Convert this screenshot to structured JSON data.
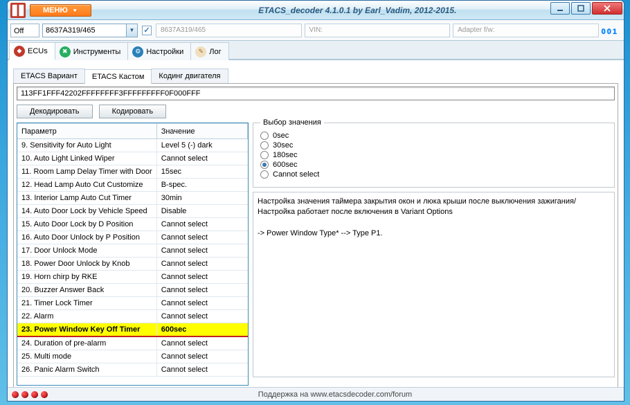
{
  "window": {
    "title": "ETACS_decoder 4.1.0.1 by Earl_Vadim, 2012-2015.",
    "menu_button": "МЕНЮ"
  },
  "toolbar": {
    "state_label": "Off",
    "combo_value": "8637A319/465",
    "check_value": "✓",
    "info1": "8637A319/465",
    "info2_hdr": "VIN:",
    "info3_hdr": "Adapter f/w:",
    "counter": "001"
  },
  "main_tabs": {
    "t1": "ECUs",
    "t2": "Инструменты",
    "t3": "Настройки",
    "t4": "Лог"
  },
  "sub_tabs": {
    "s1": "ETACS Вариант",
    "s2": "ETACS Кастом",
    "s3": "Кодинг двигателя"
  },
  "hex_value": "113FF1FFF42202FFFFFFFF3FFFFFFFFF0F000FFF",
  "buttons": {
    "decode": "Декодировать",
    "encode": "Кодировать"
  },
  "grid": {
    "col1": "Параметр",
    "col2": "Значение",
    "rows": [
      {
        "p": "9. Sensitivity for Auto Light",
        "v": "Level 5 (-) dark",
        "sel": false
      },
      {
        "p": "10. Auto Light Linked Wiper",
        "v": "Cannot select",
        "sel": false
      },
      {
        "p": "11. Room Lamp Delay Timer with Door",
        "v": "15sec",
        "sel": false
      },
      {
        "p": "12. Head Lamp Auto Cut Customize",
        "v": "B-spec.",
        "sel": false
      },
      {
        "p": "13. Interior Lamp Auto Cut Timer",
        "v": "30min",
        "sel": false
      },
      {
        "p": "14. Auto Door Lock by Vehicle Speed",
        "v": "Disable",
        "sel": false
      },
      {
        "p": "15. Auto Door Lock by D Position",
        "v": "Cannot select",
        "sel": false
      },
      {
        "p": "16. Auto Door Unlock by P Position",
        "v": "Cannot select",
        "sel": false
      },
      {
        "p": "17. Door Unlock Mode",
        "v": "Cannot select",
        "sel": false
      },
      {
        "p": "18. Power Door Unlock by Knob",
        "v": "Cannot select",
        "sel": false
      },
      {
        "p": "19. Horn chirp by RKE",
        "v": "Cannot select",
        "sel": false
      },
      {
        "p": "20. Buzzer Answer Back",
        "v": "Cannot select",
        "sel": false
      },
      {
        "p": "21. Timer Lock Timer",
        "v": "Cannot select",
        "sel": false
      },
      {
        "p": "22. Alarm",
        "v": "Cannot select",
        "sel": false
      },
      {
        "p": "23. Power Window Key Off Timer",
        "v": "600sec",
        "sel": true
      },
      {
        "p": "24. Duration of pre-alarm",
        "v": "Cannot select",
        "sel": false
      },
      {
        "p": "25. Multi mode",
        "v": "Cannot select",
        "sel": false
      },
      {
        "p": "26. Panic Alarm Switch",
        "v": "Cannot select",
        "sel": false
      }
    ]
  },
  "value_select": {
    "legend": "Выбор значения",
    "options": [
      {
        "label": "0sec",
        "sel": false
      },
      {
        "label": "30sec",
        "sel": false
      },
      {
        "label": "180sec",
        "sel": false
      },
      {
        "label": "600sec",
        "sel": true
      },
      {
        "label": "Cannot select",
        "sel": false
      }
    ]
  },
  "description": {
    "line1": "Настройка значения таймера закрытия окон и люка крыши после выключения зажигания/",
    "line2": "Настройка работает после включения в Variant Options",
    "line3": "-> Power Window Type* --> Type P1."
  },
  "status": {
    "support": "Поддержка на www.etacsdecoder.com/forum"
  }
}
